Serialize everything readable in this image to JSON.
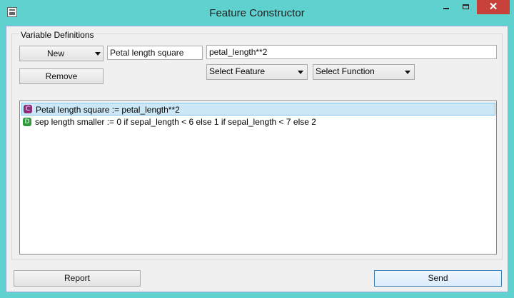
{
  "window": {
    "title": "Feature Constructor",
    "close_glyph": "✕"
  },
  "group": {
    "title": "Variable Definitions"
  },
  "controls": {
    "new_label": "New",
    "remove_label": "Remove",
    "name_value": "Petal length square",
    "expression_value": "petal_length**2",
    "select_feature": "Select Feature",
    "select_function": "Select Function"
  },
  "features": [
    {
      "badge": "C",
      "badge_color": "#8b2f7a",
      "text": "Petal length square := petal_length**2",
      "selected": true
    },
    {
      "badge": "D",
      "badge_color": "#2e9a3b",
      "text": "sep length smaller := 0 if sepal_length < 6 else 1 if sepal_length < 7 else 2",
      "selected": false
    }
  ],
  "footer": {
    "report_label": "Report",
    "send_label": "Send"
  },
  "icons": {
    "app": "table-icon",
    "minimize": "minimize-icon",
    "maximize": "maximize-icon",
    "close": "close-icon",
    "dropdown": "chevron-down-icon"
  }
}
